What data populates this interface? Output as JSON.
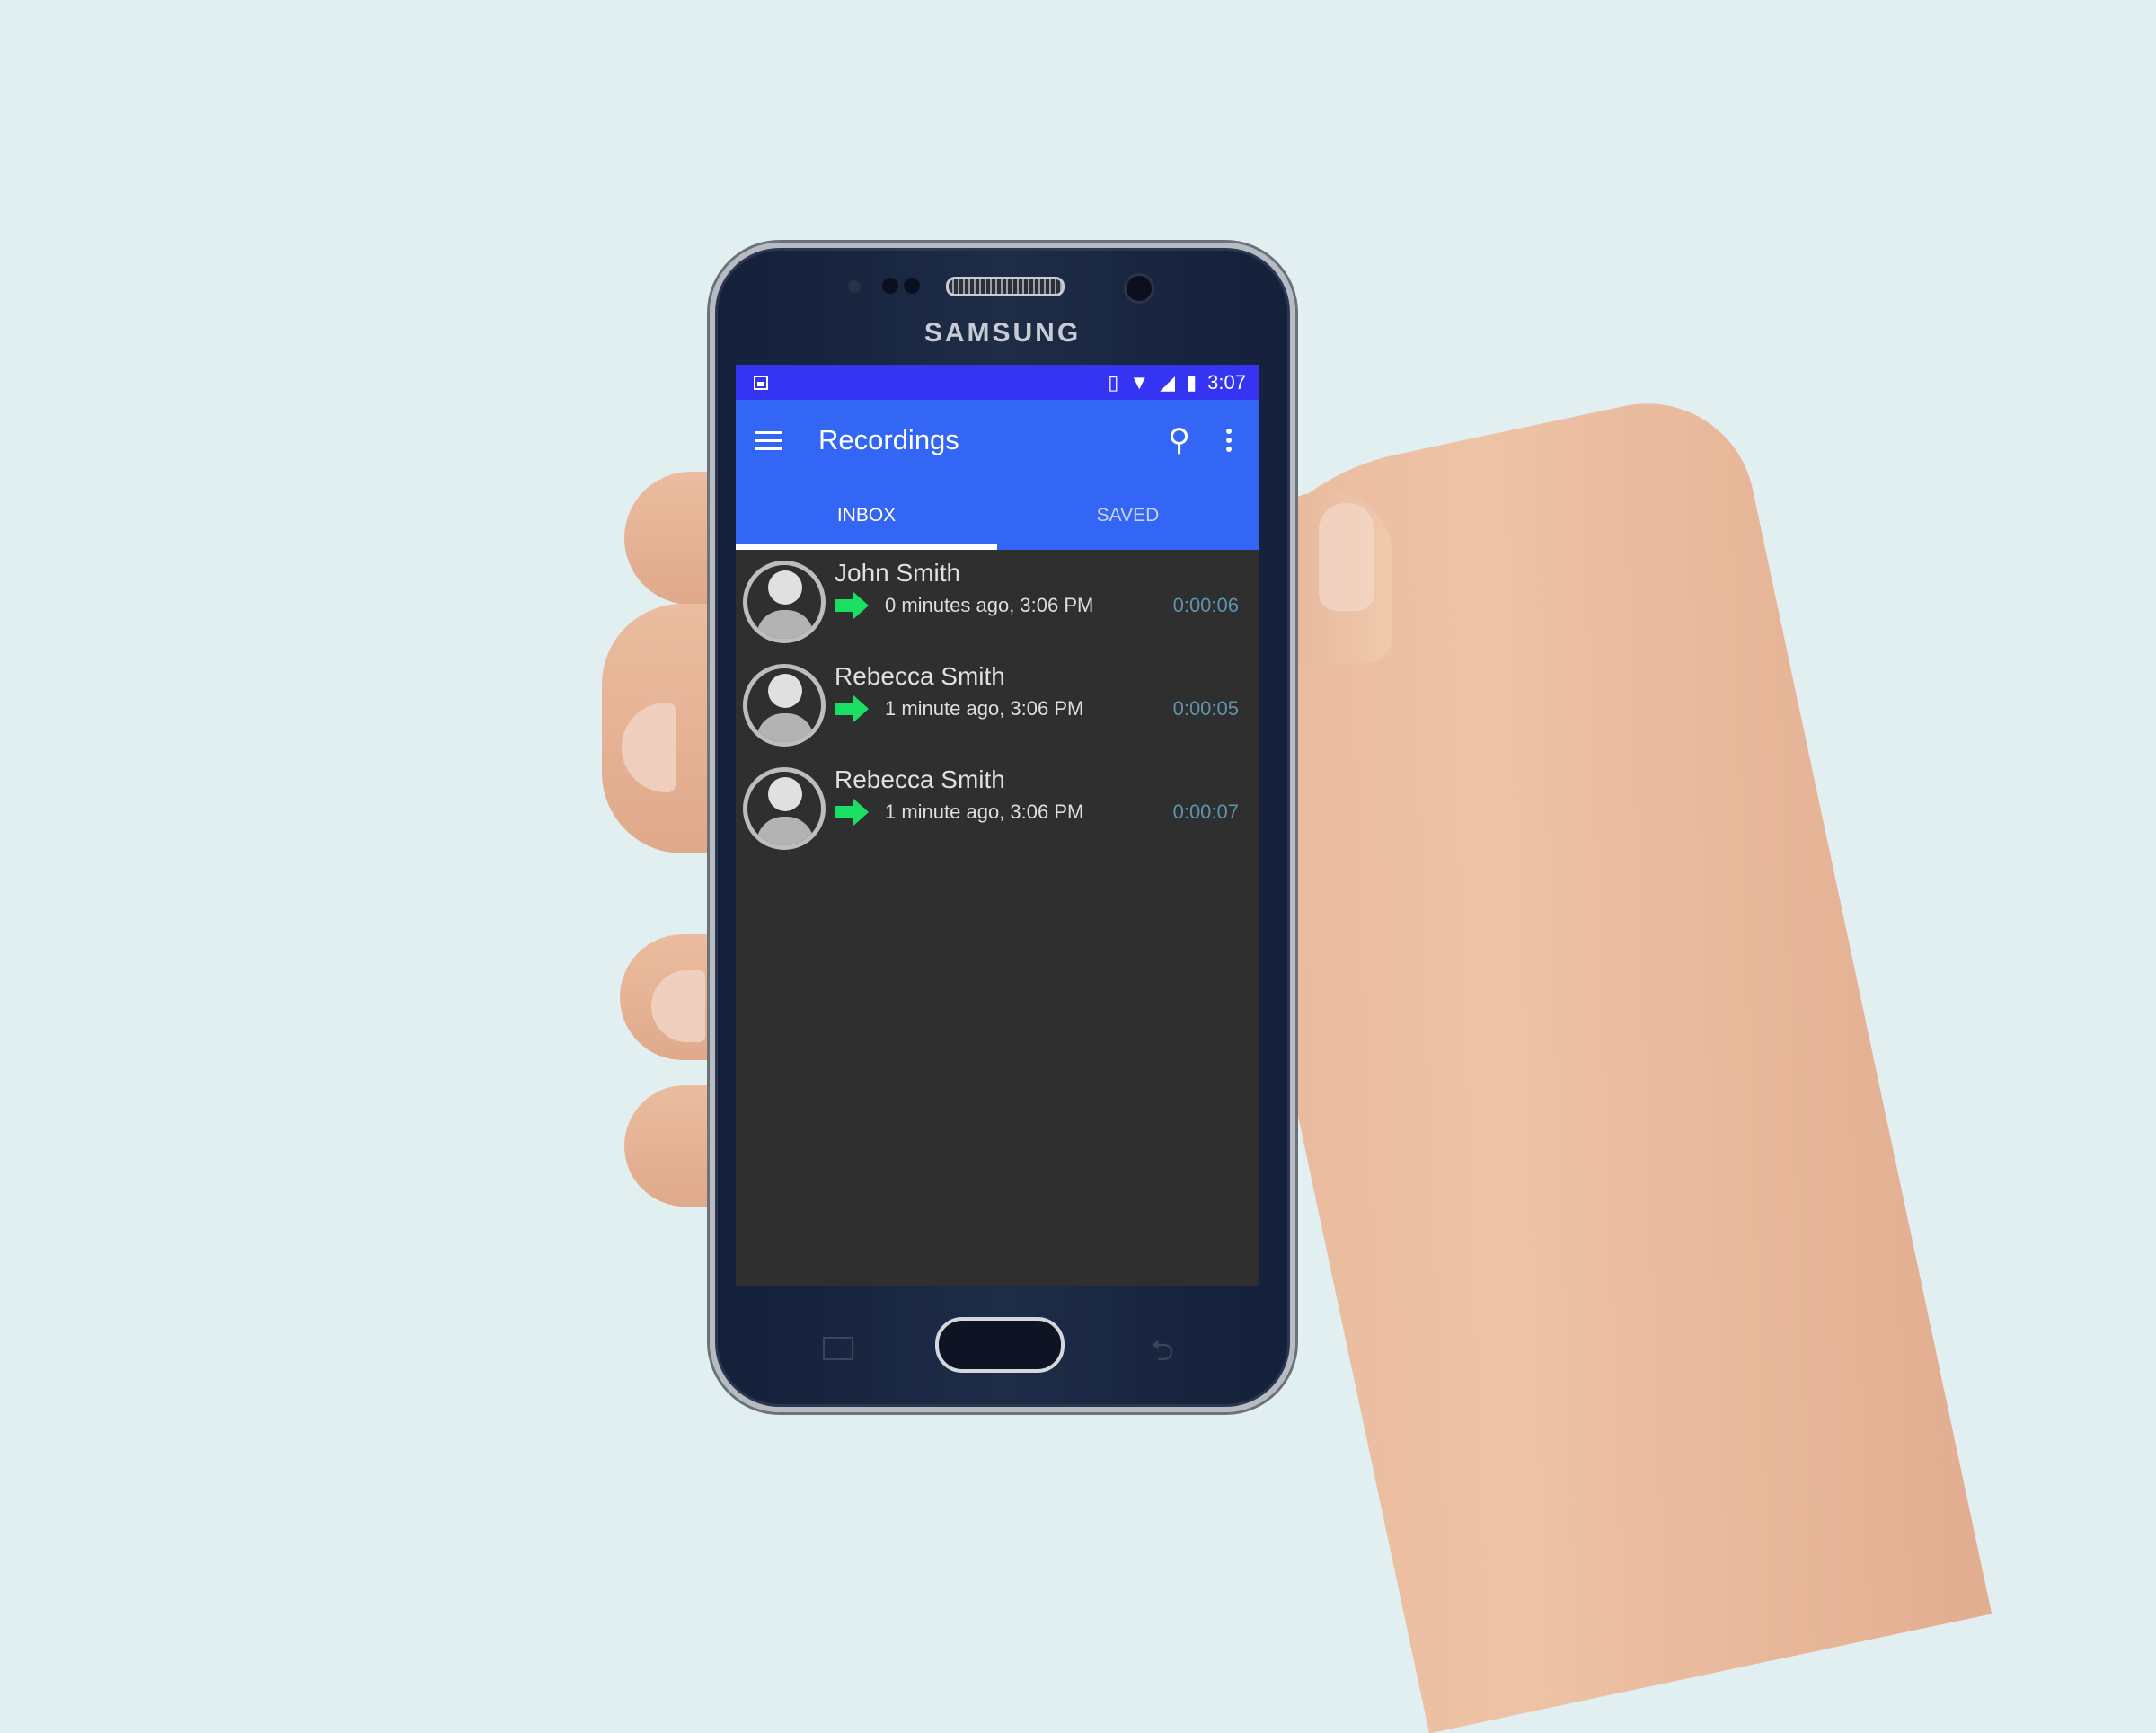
{
  "device": {
    "brand": "SAMSUNG"
  },
  "status_bar": {
    "time": "3:07",
    "left_icon": "image-notification-icon",
    "right_icons": [
      "vibrate-icon",
      "wifi-icon",
      "signal-icon",
      "battery-icon"
    ]
  },
  "toolbar": {
    "title": "Recordings",
    "menu_icon": "hamburger-icon",
    "search_icon": "search-icon",
    "more_icon": "more-vert-icon"
  },
  "tabs": [
    {
      "label": "INBOX",
      "active": true
    },
    {
      "label": "SAVED",
      "active": false
    }
  ],
  "recordings": [
    {
      "name": "John Smith",
      "when": "0 minutes ago, 3:06 PM",
      "duration": "0:00:06",
      "direction_icon": "outgoing-arrow-icon"
    },
    {
      "name": "Rebecca Smith",
      "when": "1 minute ago, 3:06 PM",
      "duration": "0:00:05",
      "direction_icon": "outgoing-arrow-icon"
    },
    {
      "name": "Rebecca Smith",
      "when": "1 minute ago, 3:06 PM",
      "duration": "0:00:07",
      "direction_icon": "outgoing-arrow-icon"
    }
  ],
  "colors": {
    "status_bar": "#3434f2",
    "toolbar": "#3366f4",
    "list_bg": "#2f2f2f",
    "arrow": "#19e063",
    "duration": "#5e93ad"
  }
}
